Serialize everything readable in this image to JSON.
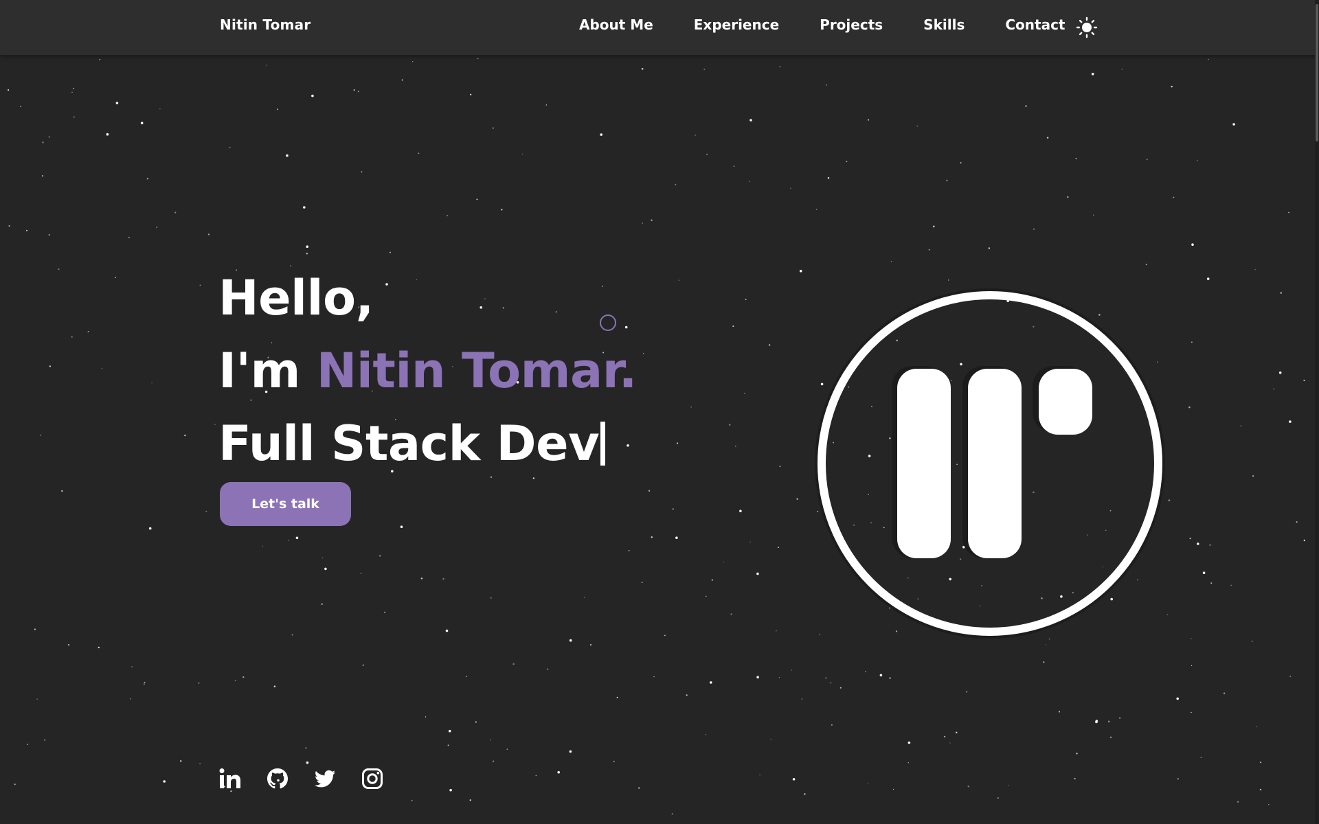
{
  "navbar": {
    "brand": "Nitin Tomar",
    "links": [
      {
        "label": "About Me"
      },
      {
        "label": "Experience"
      },
      {
        "label": "Projects"
      },
      {
        "label": "Skills"
      },
      {
        "label": "Contact"
      }
    ],
    "theme_toggle_icon": "sun-icon"
  },
  "hero": {
    "greeting": "Hello,",
    "intro_prefix": "I'm ",
    "name": "Nitin Tomar.",
    "role": "Full Stack Dev",
    "cta_label": "Let's talk"
  },
  "logo": {
    "icon": "nt-monogram-logo"
  },
  "socials": [
    {
      "icon": "linkedin-icon"
    },
    {
      "icon": "github-icon"
    },
    {
      "icon": "twitter-icon"
    },
    {
      "icon": "instagram-icon"
    }
  ],
  "colors": {
    "background": "#252526",
    "navbar": "#2e2e2f",
    "accent": "#8b73b5",
    "text": "#ffffff"
  }
}
